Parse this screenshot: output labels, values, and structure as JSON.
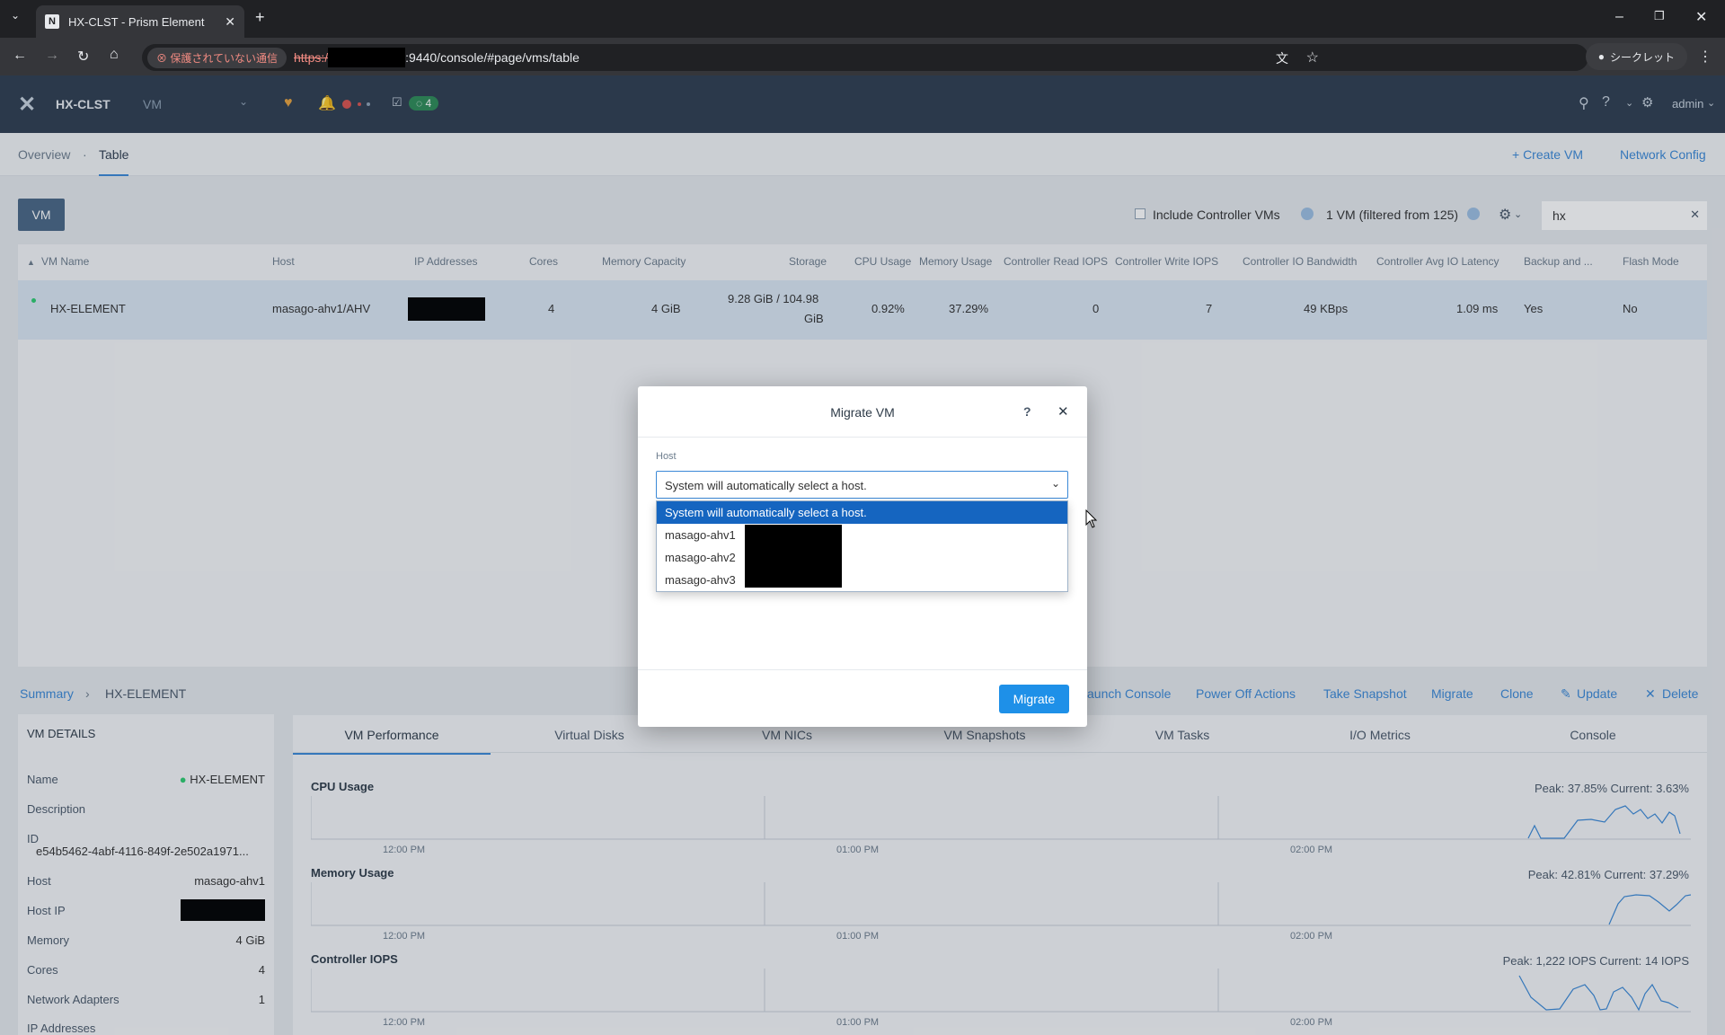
{
  "browser": {
    "tab_title": "HX-CLST - Prism Element",
    "tab_favicon": "N",
    "security_label": "保護されていない通信",
    "url_scheme": "https:/",
    "url_rest": ":9440/console/#page/vms/table",
    "incognito_label": "シークレット"
  },
  "app": {
    "cluster": "HX-CLST",
    "section": "VM",
    "task_count": "4",
    "user": "admin"
  },
  "subnav": {
    "overview": "Overview",
    "sep": "·",
    "table": "Table",
    "create_vm": "+ Create VM",
    "network_config": "Network Config"
  },
  "toolbar": {
    "vm_button": "VM",
    "include_cvms": "Include Controller VMs",
    "filter_count": "1 VM (filtered from 125)",
    "search_value": "hx"
  },
  "table": {
    "headers": [
      "VM Name",
      "Host",
      "IP Addresses",
      "Cores",
      "Memory Capacity",
      "Storage",
      "CPU Usage",
      "Memory Usage",
      "Controller Read IOPS",
      "Controller Write IOPS",
      "Controller IO Bandwidth",
      "Controller Avg IO Latency",
      "Backup and ...",
      "Flash Mode"
    ],
    "row": {
      "name": "HX-ELEMENT",
      "host": "masago-ahv1/AHV",
      "cores": "4",
      "memory": "4 GiB",
      "storage_l1": "9.28 GiB / 104.98",
      "storage_l2": "GiB",
      "cpu": "0.92%",
      "mem_usage": "37.29%",
      "read_iops": "0",
      "write_iops": "7",
      "bandwidth": "49 KBps",
      "latency": "1.09 ms",
      "backup": "Yes",
      "flash": "No"
    }
  },
  "breadcrumb": {
    "summary": "Summary",
    "vm": "HX-ELEMENT"
  },
  "actions": [
    "aunch Console",
    "Power Off Actions",
    "Take Snapshot",
    "Migrate",
    "Clone",
    "Update",
    "Delete"
  ],
  "details": {
    "title": "VM DETAILS",
    "name_label": "Name",
    "name_value": "HX-ELEMENT",
    "desc_label": "Description",
    "id_label": "ID",
    "id_value": "e54b5462-4abf-4116-849f-2e502a1971...",
    "host_label": "Host",
    "host_value": "masago-ahv1",
    "hostip_label": "Host IP",
    "memory_label": "Memory",
    "memory_value": "4 GiB",
    "cores_label": "Cores",
    "cores_value": "4",
    "nic_label": "Network Adapters",
    "nic_value": "1",
    "ip_label": "IP Addresses"
  },
  "perf_tabs": [
    "VM Performance",
    "Virtual Disks",
    "VM NICs",
    "VM Snapshots",
    "VM Tasks",
    "I/O Metrics",
    "Console"
  ],
  "charts": [
    {
      "label": "CPU Usage",
      "peak": "Peak: 37.85%  Current: 3.63%"
    },
    {
      "label": "Memory Usage",
      "peak": "Peak: 42.81%  Current: 37.29%"
    },
    {
      "label": "Controller IOPS",
      "peak": "Peak: 1,222 IOPS  Current: 14 IOPS"
    }
  ],
  "time_ticks": [
    "12:00 PM",
    "01:00 PM",
    "02:00 PM"
  ],
  "modal": {
    "title": "Migrate VM",
    "help": "?",
    "host_label": "Host",
    "selected": "System will automatically select a host.",
    "options": [
      "System will automatically select a host.",
      "masago-ahv1",
      "masago-ahv2",
      "masago-ahv3"
    ],
    "migrate_button": "Migrate"
  }
}
